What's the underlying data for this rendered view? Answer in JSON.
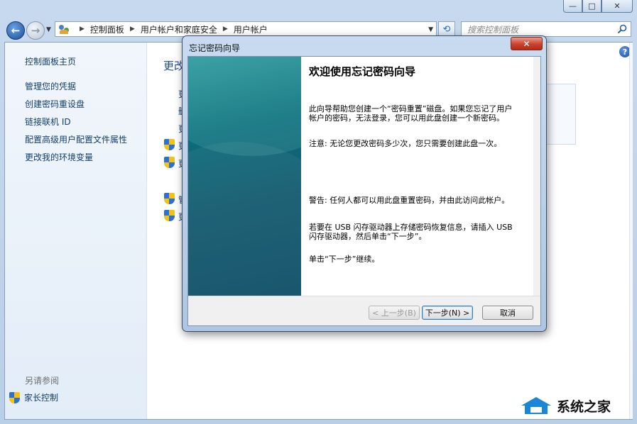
{
  "window": {
    "caption_buttons": {
      "minimize": "—",
      "maximize": "□",
      "close": "✕"
    }
  },
  "navigation": {
    "address_crumbs": [
      "控制面板",
      "用户帐户和家庭安全",
      "用户帐户"
    ],
    "search_placeholder": "搜索控制面板"
  },
  "sidebar": {
    "items": [
      {
        "label": "控制面板主页"
      },
      {
        "label": "管理您的凭据"
      },
      {
        "label": "创建密码重设盘"
      },
      {
        "label": "链接联机 ID"
      },
      {
        "label": "配置高级用户配置文件属性"
      },
      {
        "label": "更改我的环境变量"
      }
    ],
    "see_also_label": "另请参阅",
    "parental_controls_label": "家长控制"
  },
  "main": {
    "title_fragment": "更改",
    "link_fragments": [
      "更",
      "删",
      "更",
      "更",
      "更",
      "管",
      "更"
    ]
  },
  "dialog": {
    "title": "忘记密码向导",
    "close_label": "✕",
    "heading": "欢迎使用忘记密码向导",
    "paragraphs": [
      "此向导帮助您创建一个“密码重置”磁盘。如果您忘记了用户帐户的密码，无法登录，您可以用此盘创建一个新密码。",
      "注意: 无论您更改密码多少次，您只需要创建此盘一次。",
      "警告: 任何人都可以用此盘重置密码，并由此访问此帐户。",
      "若要在 USB 闪存驱动器上存储密码恢复信息，请插入 USB 闪存驱动器，然后单击“下一步”。",
      "单击“下一步”继续。"
    ],
    "buttons": {
      "back": "< 上一步(B)",
      "next": "下一步(N) >",
      "cancel": "取消"
    }
  },
  "watermark": {
    "text": "系统之家"
  },
  "colors": {
    "link": "#12406e",
    "banner": "#0c6e7b",
    "dialog_close": "#c9422d"
  }
}
